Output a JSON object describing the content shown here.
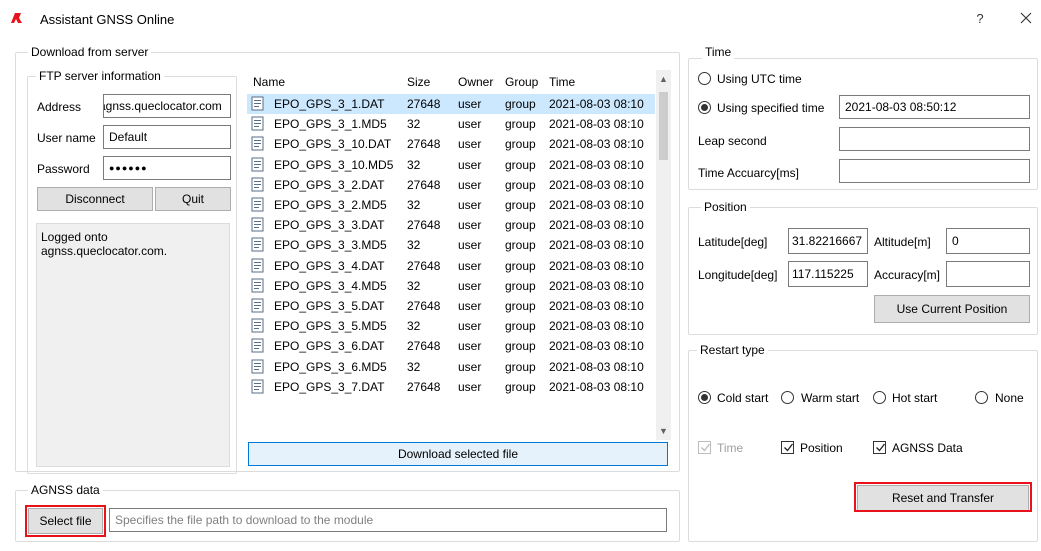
{
  "window": {
    "title": "Assistant GNSS Online",
    "help_label": "?"
  },
  "download": {
    "group_label": "Download from server",
    "ftp": {
      "group_label": "FTP server information",
      "address_label": "Address",
      "address_value": "agnss.queclocator.com",
      "username_label": "User name",
      "username_value": "Default",
      "password_label": "Password",
      "password_value": "●●●●●●",
      "disconnect_label": "Disconnect",
      "quit_label": "Quit",
      "log_text": "Logged onto agnss.queclocator.com."
    },
    "table": {
      "columns": [
        "Name",
        "Size",
        "Owner",
        "Group",
        "Time"
      ],
      "rows": [
        {
          "name": "EPO_GPS_3_1.DAT",
          "size": "27648",
          "owner": "user",
          "group": "group",
          "time": "2021-08-03 08:10"
        },
        {
          "name": "EPO_GPS_3_1.MD5",
          "size": "32",
          "owner": "user",
          "group": "group",
          "time": "2021-08-03 08:10"
        },
        {
          "name": "EPO_GPS_3_10.DAT",
          "size": "27648",
          "owner": "user",
          "group": "group",
          "time": "2021-08-03 08:10"
        },
        {
          "name": "EPO_GPS_3_10.MD5",
          "size": "32",
          "owner": "user",
          "group": "group",
          "time": "2021-08-03 08:10"
        },
        {
          "name": "EPO_GPS_3_2.DAT",
          "size": "27648",
          "owner": "user",
          "group": "group",
          "time": "2021-08-03 08:10"
        },
        {
          "name": "EPO_GPS_3_2.MD5",
          "size": "32",
          "owner": "user",
          "group": "group",
          "time": "2021-08-03 08:10"
        },
        {
          "name": "EPO_GPS_3_3.DAT",
          "size": "27648",
          "owner": "user",
          "group": "group",
          "time": "2021-08-03 08:10"
        },
        {
          "name": "EPO_GPS_3_3.MD5",
          "size": "32",
          "owner": "user",
          "group": "group",
          "time": "2021-08-03 08:10"
        },
        {
          "name": "EPO_GPS_3_4.DAT",
          "size": "27648",
          "owner": "user",
          "group": "group",
          "time": "2021-08-03 08:10"
        },
        {
          "name": "EPO_GPS_3_4.MD5",
          "size": "32",
          "owner": "user",
          "group": "group",
          "time": "2021-08-03 08:10"
        },
        {
          "name": "EPO_GPS_3_5.DAT",
          "size": "27648",
          "owner": "user",
          "group": "group",
          "time": "2021-08-03 08:10"
        },
        {
          "name": "EPO_GPS_3_5.MD5",
          "size": "32",
          "owner": "user",
          "group": "group",
          "time": "2021-08-03 08:10"
        },
        {
          "name": "EPO_GPS_3_6.DAT",
          "size": "27648",
          "owner": "user",
          "group": "group",
          "time": "2021-08-03 08:10"
        },
        {
          "name": "EPO_GPS_3_6.MD5",
          "size": "32",
          "owner": "user",
          "group": "group",
          "time": "2021-08-03 08:10"
        },
        {
          "name": "EPO_GPS_3_7.DAT",
          "size": "27648",
          "owner": "user",
          "group": "group",
          "time": "2021-08-03 08:10"
        }
      ]
    },
    "download_selected_label": "Download selected file"
  },
  "agnss": {
    "group_label": "AGNSS data",
    "select_file_label": "Select file",
    "path_placeholder": "Specifies the file path to download to the module"
  },
  "time": {
    "group_label": "Time",
    "utc_label": "Using UTC time",
    "specified_label": "Using specified time",
    "specified_value": "2021-08-03 08:50:12",
    "leap_label": "Leap second",
    "accuracy_label": "Time Accuarcy[ms]"
  },
  "position": {
    "group_label": "Position",
    "lat_label": "Latitude[deg]",
    "lat_value": "31.82216667",
    "alt_label": "Altitude[m]",
    "alt_value": "0",
    "lon_label": "Longitude[deg]",
    "lon_value": "117.115225",
    "acc_label": "Accuracy[m]",
    "use_current_label": "Use Current Position"
  },
  "restart": {
    "group_label": "Restart type",
    "options": [
      "Cold start",
      "Warm start",
      "Hot start",
      "None"
    ],
    "selected": "Cold start",
    "checks": [
      {
        "label": "Time",
        "checked": true,
        "enabled": false
      },
      {
        "label": "Position",
        "checked": true,
        "enabled": true
      },
      {
        "label": "AGNSS Data",
        "checked": true,
        "enabled": true
      }
    ],
    "reset_label": "Reset and Transfer"
  },
  "colors": {
    "highlight": "#e8121a",
    "selection": "#cce8ff",
    "accent_border": "#0078d7"
  }
}
